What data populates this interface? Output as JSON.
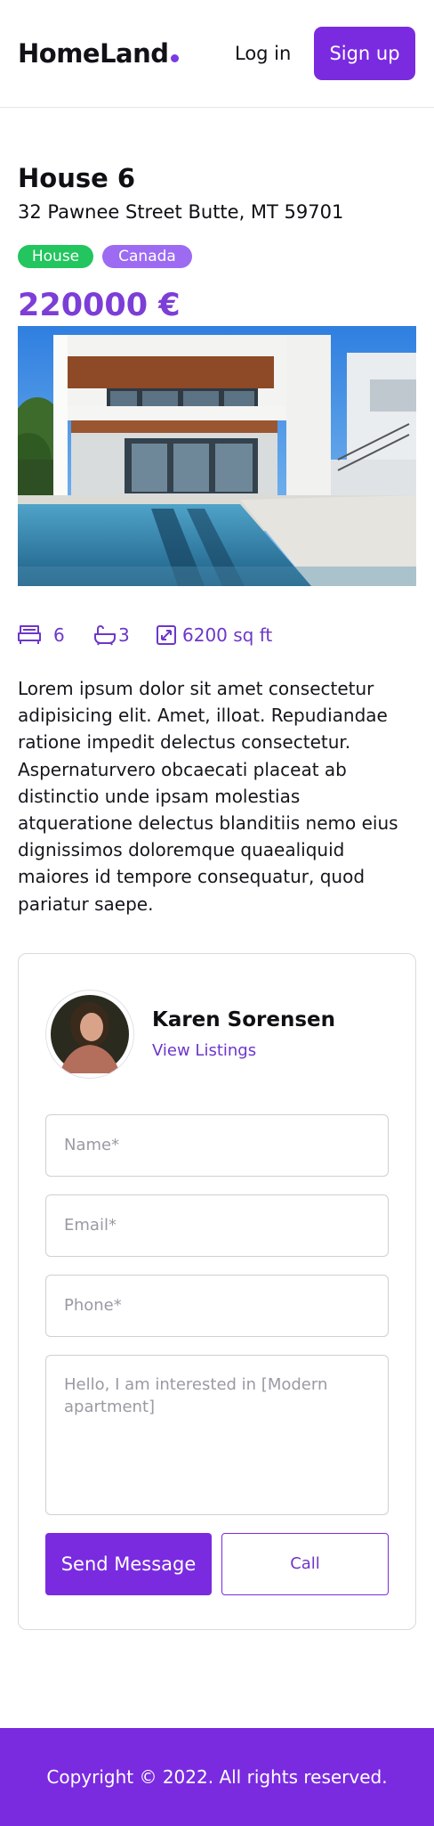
{
  "header": {
    "logo": "HomeLand",
    "login_label": "Log in",
    "signup_label": "Sign up"
  },
  "listing": {
    "title": "House 6",
    "address": "32 Pawnee Street Butte, MT 59701",
    "badges": {
      "type": "House",
      "country": "Canada"
    },
    "price": "220000 €",
    "features": {
      "beds": "6",
      "baths": "3",
      "area": "6200 sq ft"
    },
    "description": "Lorem ipsum dolor sit amet consectetur adipisicing elit. Amet, illoat. Repudiandae ratione impedit delectus consectetur. Aspernaturvero obcaecati placeat ab distinctio unde ipsam molestias atqueratione delectus blanditiis nemo eius dignissimos doloremque quaealiquid maiores id tempore consequatur, quod pariatur saepe."
  },
  "agent": {
    "name": "Karen Sorensen",
    "link_label": "View Listings"
  },
  "form": {
    "name_placeholder": "Name*",
    "email_placeholder": "Email*",
    "phone_placeholder": "Phone*",
    "message_placeholder": "Hello, I am interested in [Modern apartment]",
    "send_label": "Send Message",
    "call_label": "Call"
  },
  "footer": {
    "copyright": "Copyright © 2022. All rights reserved."
  },
  "colors": {
    "accent": "#7a2be0",
    "accent_text": "#6d37c9",
    "badge_type": "#22c55e",
    "badge_country": "#9c6bf2"
  },
  "icons": [
    "bed-icon",
    "bath-icon",
    "area-icon"
  ]
}
